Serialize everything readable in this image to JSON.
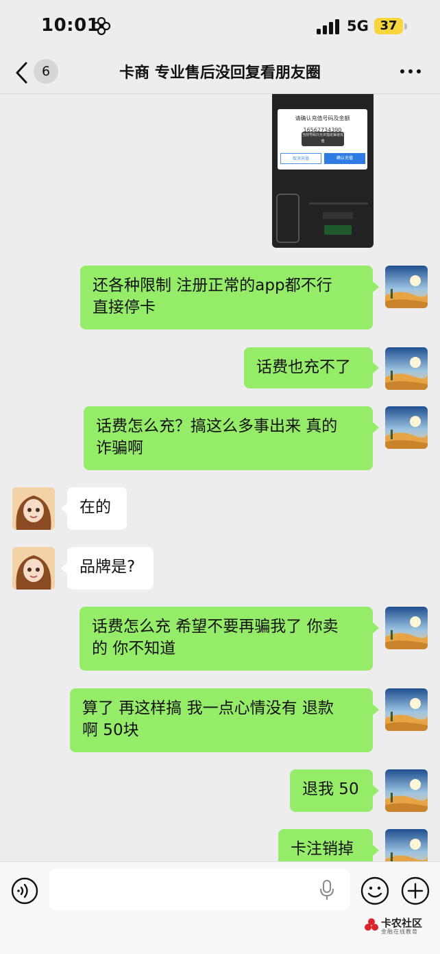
{
  "status_bar": {
    "time": "10:01",
    "network": "5G",
    "battery": "37"
  },
  "nav": {
    "back_count": "6",
    "title": "卡商 专业售后没回复看朋友圈"
  },
  "shared_screenshot": {
    "dialog_title": "请确认充值号码及金额",
    "phone_number": "16562734390",
    "tooltip": "当前号码只允许指定渠道充值",
    "cancel_label": "取消充值",
    "confirm_label": "确认充值"
  },
  "messages": [
    {
      "side": "out",
      "lines": [
        "还各种限制 注册正常的app都不行",
        "直接停卡"
      ]
    },
    {
      "side": "out",
      "lines": [
        "话费也充不了"
      ]
    },
    {
      "side": "out",
      "lines": [
        "话费怎么充？搞这么多事出来 真的",
        "诈骗啊"
      ]
    },
    {
      "side": "in",
      "lines": [
        "在的"
      ]
    },
    {
      "side": "in",
      "lines": [
        "品牌是?"
      ]
    },
    {
      "side": "out",
      "lines": [
        "话费怎么充 希望不要再骗我了 你卖",
        "的 你不知道"
      ]
    },
    {
      "side": "out",
      "lines": [
        "算了 再这样搞 我一点心情没有 退款",
        "啊 50块"
      ]
    },
    {
      "side": "out",
      "lines": [
        "退我 50"
      ]
    },
    {
      "side": "out",
      "lines": [
        "卡注销掉"
      ]
    }
  ],
  "watermark": {
    "title": "卡农社区",
    "subtitle": "金融在线教育"
  },
  "colors": {
    "outgoing_bubble": "#95ec69",
    "incoming_bubble": "#ffffff",
    "background": "#ededed",
    "battery": "#f7d53b"
  }
}
